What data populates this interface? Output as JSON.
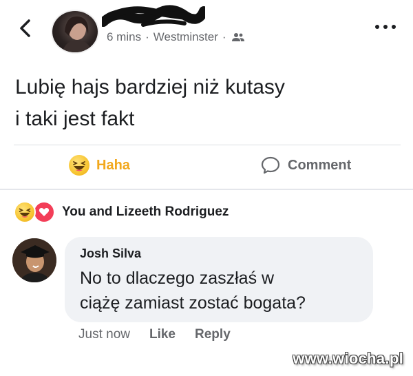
{
  "header": {
    "meta_time": "6 mins",
    "meta_sep": "·",
    "meta_location": "Westminster",
    "meta_sep2": "·"
  },
  "post": {
    "line1": "Lubię hajs bardziej niż kutasy",
    "line2": "i taki jest fakt"
  },
  "actions": {
    "haha_label": "Haha",
    "comment_label": "Comment",
    "haha_color": "#f2a81d"
  },
  "reactions": {
    "text": "You and Lizeeth Rodriguez"
  },
  "comment": {
    "author": "Josh Silva",
    "line1": "No to dlaczego zaszłaś w",
    "line2": "ciążę zamiast zostać bogata?",
    "time": "Just now",
    "like_label": "Like",
    "reply_label": "Reply"
  },
  "watermark": "www.wiocha.pl",
  "icons": {
    "back": "chevron-left-icon",
    "more": "more-dots-icon",
    "audience": "friends-icon",
    "haha": "haha-emoji-icon",
    "comment": "comment-bubble-icon",
    "heart": "love-heart-icon"
  },
  "colors": {
    "accent_haha": "#f2a81d",
    "heart": "#f33e58",
    "bubble_bg": "#f0f2f5",
    "meta_text": "#65676b"
  }
}
